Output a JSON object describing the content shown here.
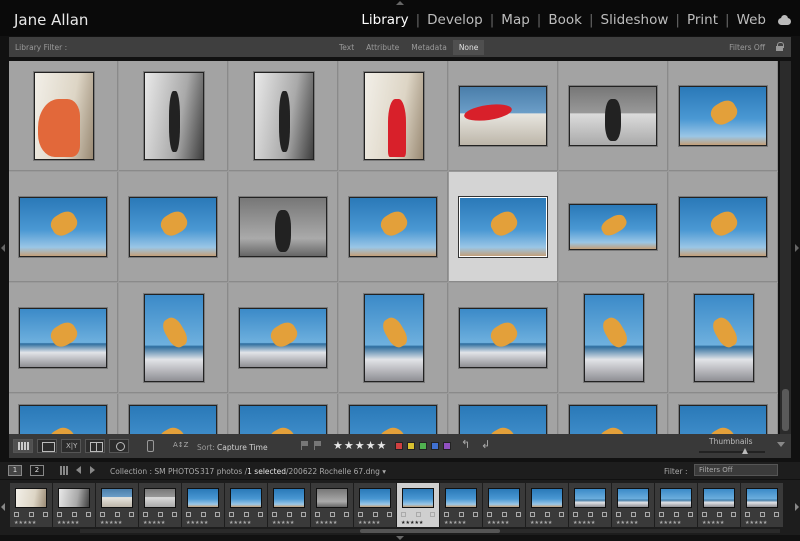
{
  "header": {
    "user_name": "Jane Allan",
    "modules": [
      "Library",
      "Develop",
      "Map",
      "Book",
      "Slideshow",
      "Print",
      "Web"
    ],
    "active_module": "Library"
  },
  "filter_bar": {
    "label": "Library Filter :",
    "options": [
      "Text",
      "Attribute",
      "Metadata",
      "None"
    ],
    "active_option": "None",
    "status": "Filters Off"
  },
  "toolbar": {
    "sort_label": "Sort:",
    "sort_value": "Capture Time",
    "compare_label": "X|Y",
    "az_label": "A↕Z",
    "stars": "★★★★★",
    "color_labels": [
      "#d04040",
      "#d8c030",
      "#50b050",
      "#4070d0",
      "#9050c0"
    ],
    "thumbnails_label": "Thumbnails",
    "thumbnail_size": 0.7
  },
  "status_bar": {
    "page_1": "1",
    "page_2": "2",
    "collection": "Collection : SM PHOTOS",
    "count": "317 photos /",
    "selected": "1 selected",
    "file": "/200622 Rochelle 67.dng ▾",
    "filter_label": "Filter :",
    "filter_value": "Filters Off"
  },
  "filmstrip": {
    "stars": "★★★★★"
  },
  "grid": {
    "selected_index": 11
  }
}
